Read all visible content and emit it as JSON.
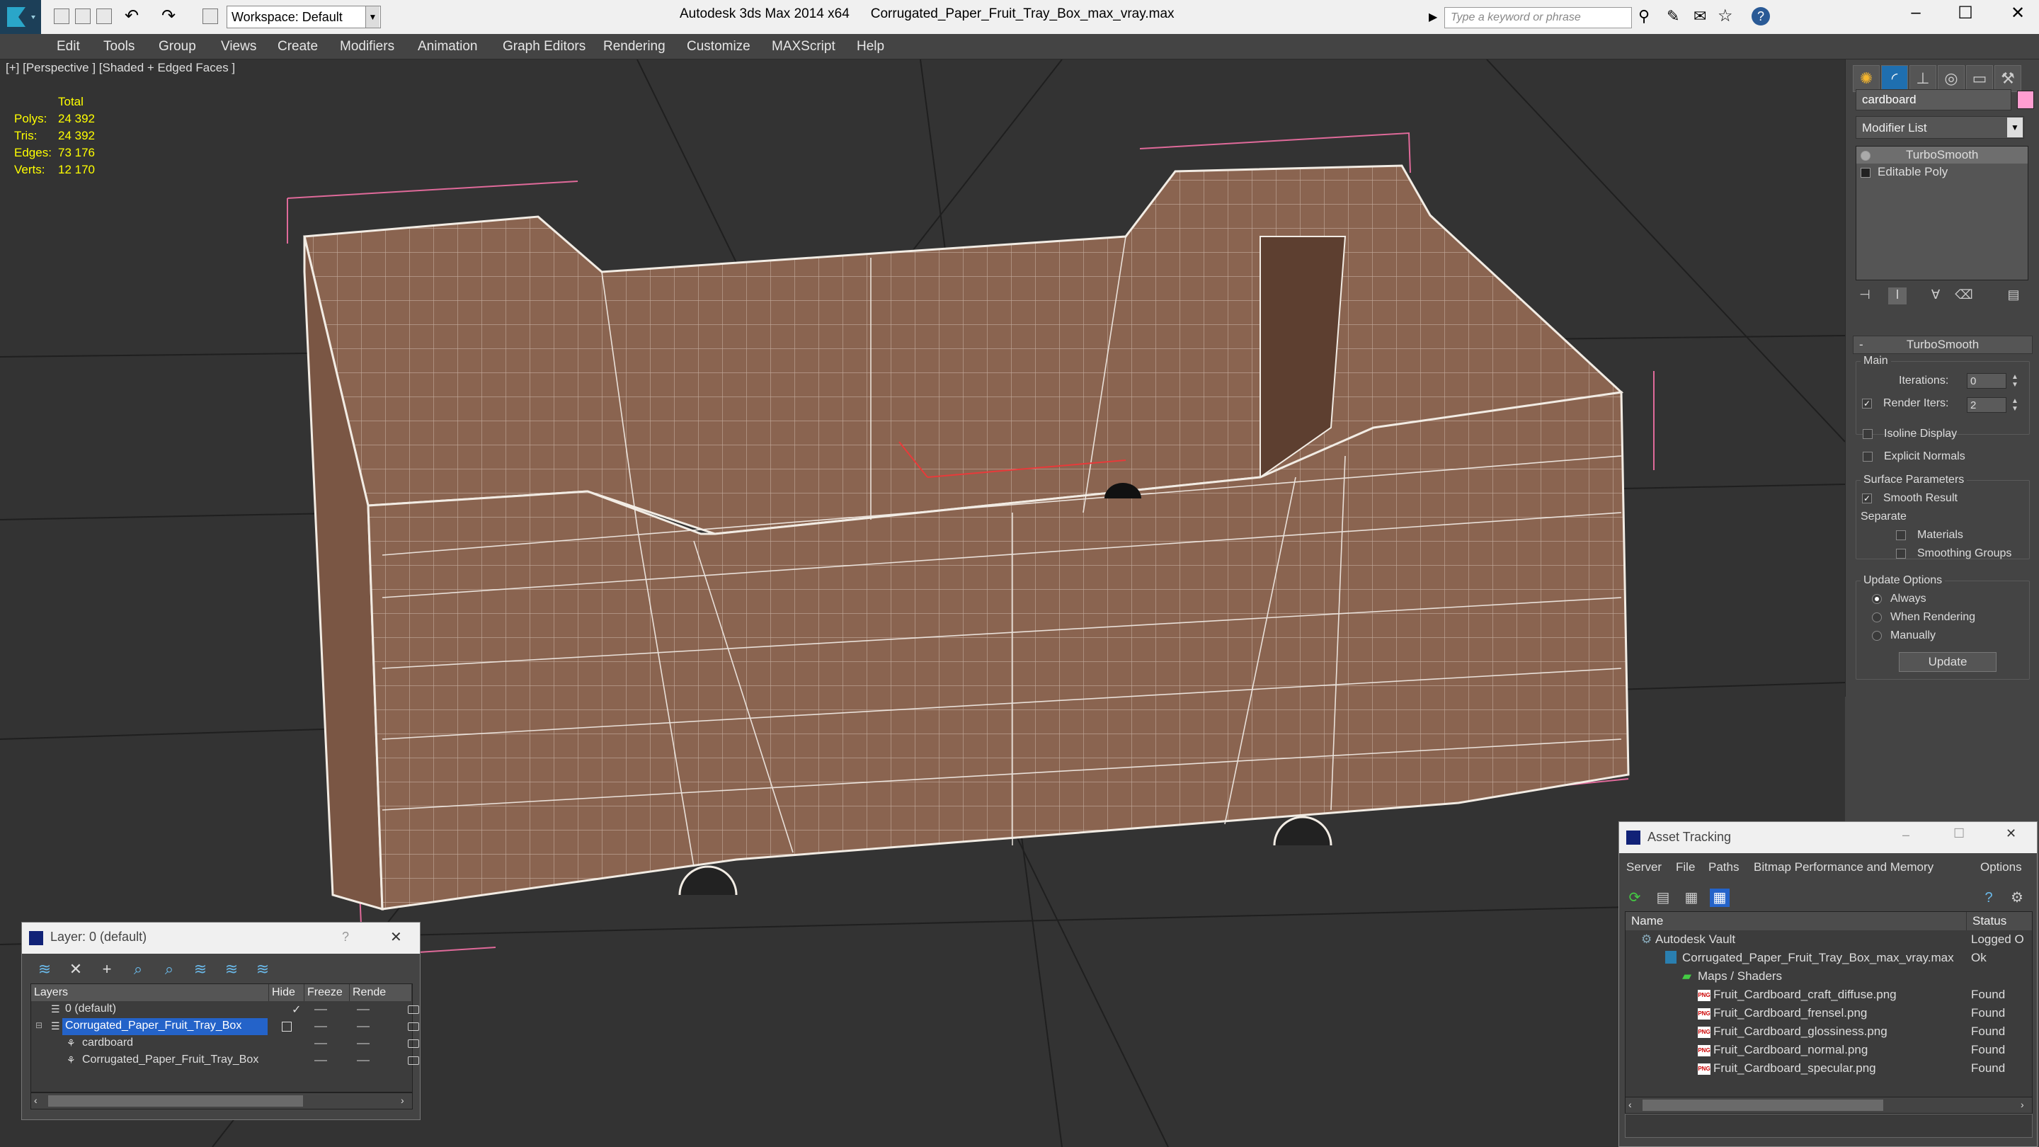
{
  "titlebar": {
    "app": "Autodesk 3ds Max  2014 x64",
    "file": "Corrugated_Paper_Fruit_Tray_Box_max_vray.max",
    "workspace": "Workspace: Default",
    "search_placeholder": "Type a keyword or phrase",
    "minimize": "–",
    "maximize": "☐",
    "close": "✕"
  },
  "menu": [
    "Edit",
    "Tools",
    "Group",
    "Views",
    "Create",
    "Modifiers",
    "Animation",
    "Graph Editors",
    "Rendering",
    "Customize",
    "MAXScript",
    "Help"
  ],
  "viewport": {
    "label": "[+] [Perspective ] [Shaded + Edged Faces ]",
    "stats": {
      "header": "Total",
      "rows": [
        {
          "k": "Polys:",
          "v": "24 392"
        },
        {
          "k": "Tris:",
          "v": "24 392"
        },
        {
          "k": "Edges:",
          "v": "73 176"
        },
        {
          "k": "Verts:",
          "v": "12 170"
        }
      ]
    }
  },
  "command_panel": {
    "object_name": "cardboard",
    "object_color": "#ff9ed1",
    "modifier_list": "Modifier List",
    "stack": [
      "TurboSmooth",
      "Editable Poly"
    ],
    "rollout": "TurboSmooth",
    "main_group": "Main",
    "iterations_label": "Iterations:",
    "iterations": "0",
    "render_iters_label": "Render Iters:",
    "render_iters": "2",
    "isoline": "Isoline Display",
    "explicit_normals": "Explicit Normals",
    "surface_group": "Surface Parameters",
    "smooth_result": "Smooth Result",
    "separate": "Separate",
    "materials": "Materials",
    "smoothing_groups": "Smoothing Groups",
    "update_group": "Update Options",
    "always": "Always",
    "when_rendering": "When Rendering",
    "manually": "Manually",
    "update_btn": "Update"
  },
  "layer_window": {
    "title": "Layer: 0 (default)",
    "help": "?",
    "close": "✕",
    "headers": [
      "Layers",
      "Hide",
      "Freeze",
      "Rende"
    ],
    "rows": [
      "0 (default)",
      "Corrugated_Paper_Fruit_Tray_Box",
      "cardboard",
      "Corrugated_Paper_Fruit_Tray_Box"
    ]
  },
  "asset_window": {
    "title": "Asset Tracking",
    "menus": [
      "Server",
      "File",
      "Paths",
      "Bitmap Performance and Memory",
      "Options"
    ],
    "headers": [
      "Name",
      "Status"
    ],
    "rows": [
      {
        "name": "Autodesk Vault",
        "status": "Logged O"
      },
      {
        "name": "Corrugated_Paper_Fruit_Tray_Box_max_vray.max",
        "status": "Ok"
      },
      {
        "name": "Maps / Shaders",
        "status": ""
      },
      {
        "name": "Fruit_Cardboard_craft_diffuse.png",
        "status": "Found"
      },
      {
        "name": "Fruit_Cardboard_frensel.png",
        "status": "Found"
      },
      {
        "name": "Fruit_Cardboard_glossiness.png",
        "status": "Found"
      },
      {
        "name": "Fruit_Cardboard_normal.png",
        "status": "Found"
      },
      {
        "name": "Fruit_Cardboard_specular.png",
        "status": "Found"
      }
    ],
    "file_icon": "PNG"
  }
}
